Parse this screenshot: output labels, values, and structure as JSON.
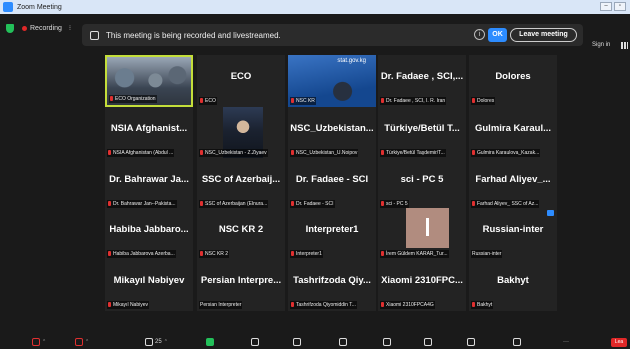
{
  "window": {
    "title": "Zoom Meeting"
  },
  "topbar": {
    "recording_label": "Recording",
    "more_glyph": "⁝",
    "banner_message": "This meeting is being recorded and livestreamed.",
    "info_glyph": "i",
    "ok_label": "OK",
    "leave_label": "Leave meeting",
    "signin_label": "Sign in"
  },
  "tiles": [
    {
      "big": "",
      "label": "ECO Organization",
      "photo": "group"
    },
    {
      "big": "ECO",
      "label": "ECO"
    },
    {
      "big": "",
      "label": "NSC KR",
      "photo": "statgov",
      "photo_text": "stat.gov.kg"
    },
    {
      "big": "Dr. Fadaee , SCI,...",
      "label": "Dr. Fadaee , SCI, I. R. Iran"
    },
    {
      "big": "Dolores",
      "label": "Dolores"
    },
    {
      "big": "NSIA Afghanist...",
      "label": "NSIA Afghanistan (Abdul ..."
    },
    {
      "big": "",
      "label": "NSC_Uzbekistan - Z.Ziyaev",
      "photo": "man"
    },
    {
      "big": "NSC_Uzbekistan...",
      "label": "NSC_Uzbekistan_U.Noipov"
    },
    {
      "big": "Türkiye/Betül T...",
      "label": "Türkiye/Betül Taşdemir/T..."
    },
    {
      "big": "Gulmira Karaul...",
      "label": "Gulmira Karaulova_Kazak..."
    },
    {
      "big": "Dr. Bahrawar Ja...",
      "label": "Dr. Bahrawar Jan--Pakista..."
    },
    {
      "big": "SSC of Azerbaij...",
      "label": "SSC of Azerbaijan (Elnura..."
    },
    {
      "big": "Dr. Fadaee - SCI",
      "label": "Dr. Fadaee - SCI"
    },
    {
      "big": "sci - PC 5",
      "label": "sci - PC 5"
    },
    {
      "big": "Farhad Aliyev_...",
      "label": "Farhad Aliyev_ SSC of Az..."
    },
    {
      "big": "Habiba Jabbaro...",
      "label": "Habiba Jabbarova Azerba..."
    },
    {
      "big": "NSC KR 2",
      "label": "NSC KR 2"
    },
    {
      "big": "Interpreter1",
      "label": "Interpreter1"
    },
    {
      "big": "",
      "label": "İrem Güldem KARAR_Tur...",
      "photo": "pink"
    },
    {
      "big": "Russian-inter",
      "label": "Russian-inter",
      "nomic": true,
      "badge": true
    },
    {
      "big": "Mikayıl Nəbiyev",
      "label": "Mikayıl Nabiyev"
    },
    {
      "big": "Persian Interpre...",
      "label": "Persian Interpreter",
      "nomic": true
    },
    {
      "big": "Tashrifzoda Qiy...",
      "label": "Tashrifzoda Qiyomiddin T..."
    },
    {
      "big": "Xiaomi 2310FPC...",
      "label": "Xiaomi 2310FPCA4G"
    },
    {
      "big": "Bakhyt",
      "label": "Bakhyt"
    }
  ],
  "toolbar": {
    "participants_count": "25",
    "end_label": "Lea"
  }
}
